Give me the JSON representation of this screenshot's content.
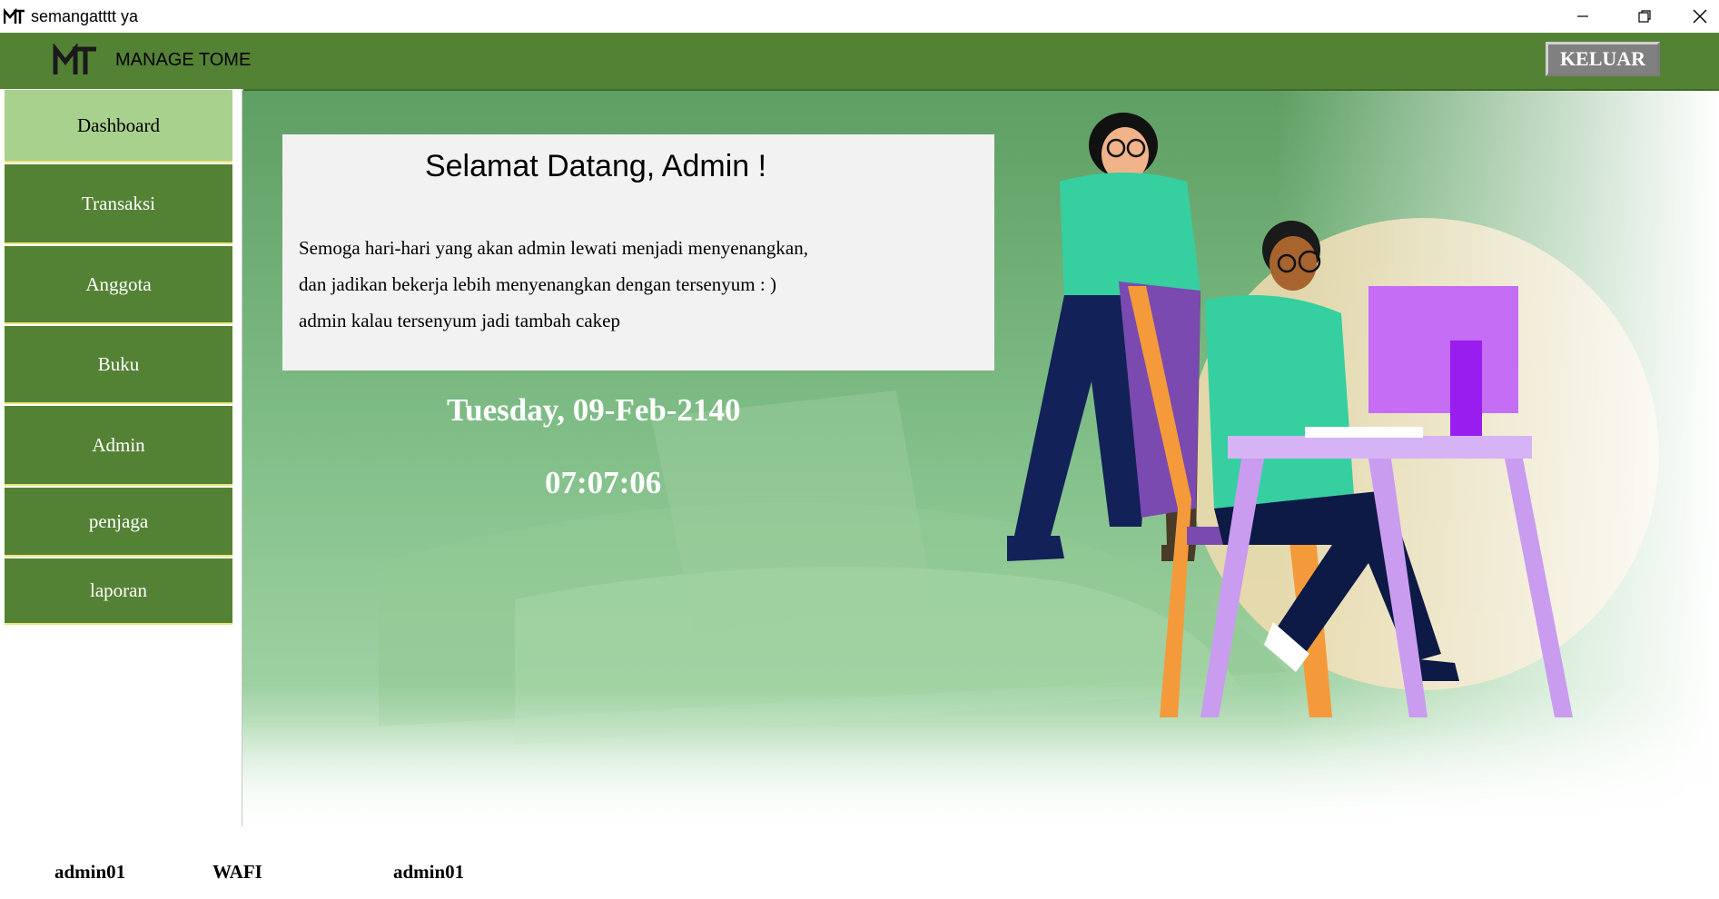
{
  "window": {
    "title": "semangatttt ya",
    "logo": "MT"
  },
  "header": {
    "app_title": "MANAGE TOME",
    "logout_label": "KELUAR"
  },
  "sidebar": {
    "items": [
      {
        "label": "Dashboard",
        "active": true
      },
      {
        "label": "Transaksi"
      },
      {
        "label": "Anggota"
      },
      {
        "label": "Buku"
      },
      {
        "label": "Admin"
      },
      {
        "label": "penjaga"
      },
      {
        "label": "laporan"
      }
    ]
  },
  "main": {
    "welcome_title": "Selamat Datang, Admin !",
    "welcome_lines": [
      "Semoga hari-hari yang akan admin lewati menjadi menyenangkan,",
      "dan jadikan bekerja lebih menyenangkan dengan tersenyum : )",
      "admin kalau tersenyum jadi tambah cakep"
    ],
    "date": "Tuesday, 09-Feb-2140",
    "time": "07:07:06"
  },
  "footer": {
    "username": "admin01",
    "name": "WAFI",
    "role": "admin01"
  },
  "colors": {
    "header_green": "#548235",
    "sidebar_active": "#a9d18e",
    "banner_green": "#6aad74"
  }
}
